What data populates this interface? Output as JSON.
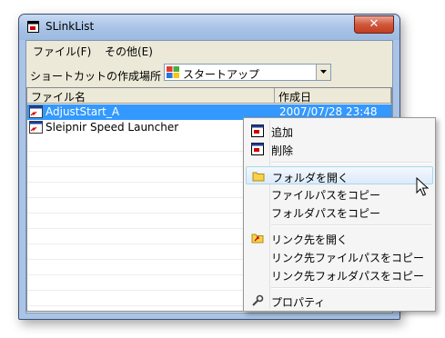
{
  "window": {
    "title": "SLinkList",
    "close_label": "✕"
  },
  "menu": [
    "ファイル(F)",
    "その他(E)"
  ],
  "location": {
    "label": "ショートカットの作成場所",
    "value": "スタートアップ"
  },
  "columns": [
    "ファイル名",
    "作成日"
  ],
  "rows": [
    {
      "name": "AdjustStart_A",
      "date": "2007/07/28 23:48",
      "selected": true
    },
    {
      "name": "Sleipnir Speed Launcher",
      "date": "",
      "selected": false
    }
  ],
  "context_menu": {
    "items": [
      {
        "label": "追加",
        "icon": "window-icon"
      },
      {
        "label": "削除",
        "icon": "window-icon"
      },
      {
        "label": "フォルダを開く",
        "icon": "folder-icon",
        "highlighted": true
      },
      {
        "label": "ファイルパスをコピー"
      },
      {
        "label": "フォルダパスをコピー"
      },
      {
        "label": "リンク先を開く",
        "icon": "folder-link-icon"
      },
      {
        "label": "リンク先ファイルパスをコピー"
      },
      {
        "label": "リンク先フォルダパスをコピー"
      },
      {
        "label": "プロパティ",
        "icon": "properties-icon"
      }
    ]
  },
  "colors": {
    "selection": "#3399ff",
    "titlebar": "#a7c2e5",
    "close": "#c8442a"
  }
}
